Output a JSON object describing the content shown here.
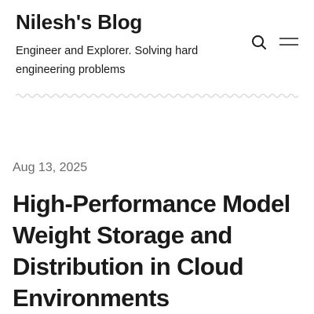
{
  "site": {
    "title": "Nilesh's Blog",
    "description": "Engineer and Explorer. Solving hard engineering problems"
  },
  "header": {
    "icons": {
      "search": "search-icon",
      "menu": "hamburger-menu-icon"
    }
  },
  "post": {
    "date": "Aug 13, 2025",
    "title": "High-Performance Model Weight Storage and Distribution in Cloud Environments"
  },
  "colors": {
    "text": "#1a1a1a",
    "muted": "#6b6b6b",
    "divider": "#dcdcdc",
    "background": "#ffffff"
  }
}
